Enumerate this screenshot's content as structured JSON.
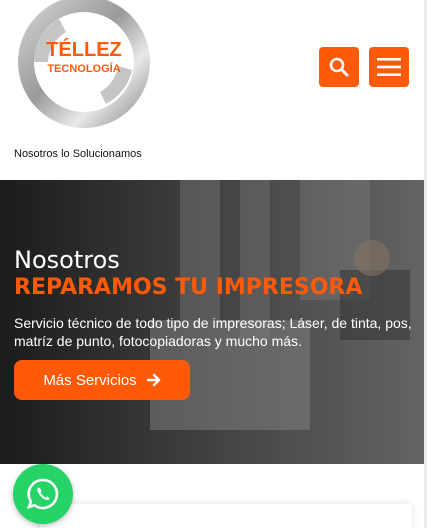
{
  "header": {
    "logo": {
      "line1": "TÉLLEZ",
      "line2": "TECNOLOGÍA"
    },
    "tagline": "Nosotros lo Solucionamos",
    "search_icon": "search-icon",
    "menu_icon": "hamburger-menu-icon"
  },
  "hero": {
    "title": "Nosotros",
    "subtitle": "REPARAMOS TU IMPRESORA",
    "description": "Servicio técnico de todo tipo de impresoras; Láser, de tinta, pos, matríz de punto, fotocopiadoras y mucho más.",
    "button_label": "Más Servicios",
    "button_icon": "arrow-right-icon"
  },
  "floating": {
    "whatsapp_icon": "whatsapp-icon"
  },
  "colors": {
    "accent": "#ff5a0a",
    "whatsapp": "#25d366"
  }
}
